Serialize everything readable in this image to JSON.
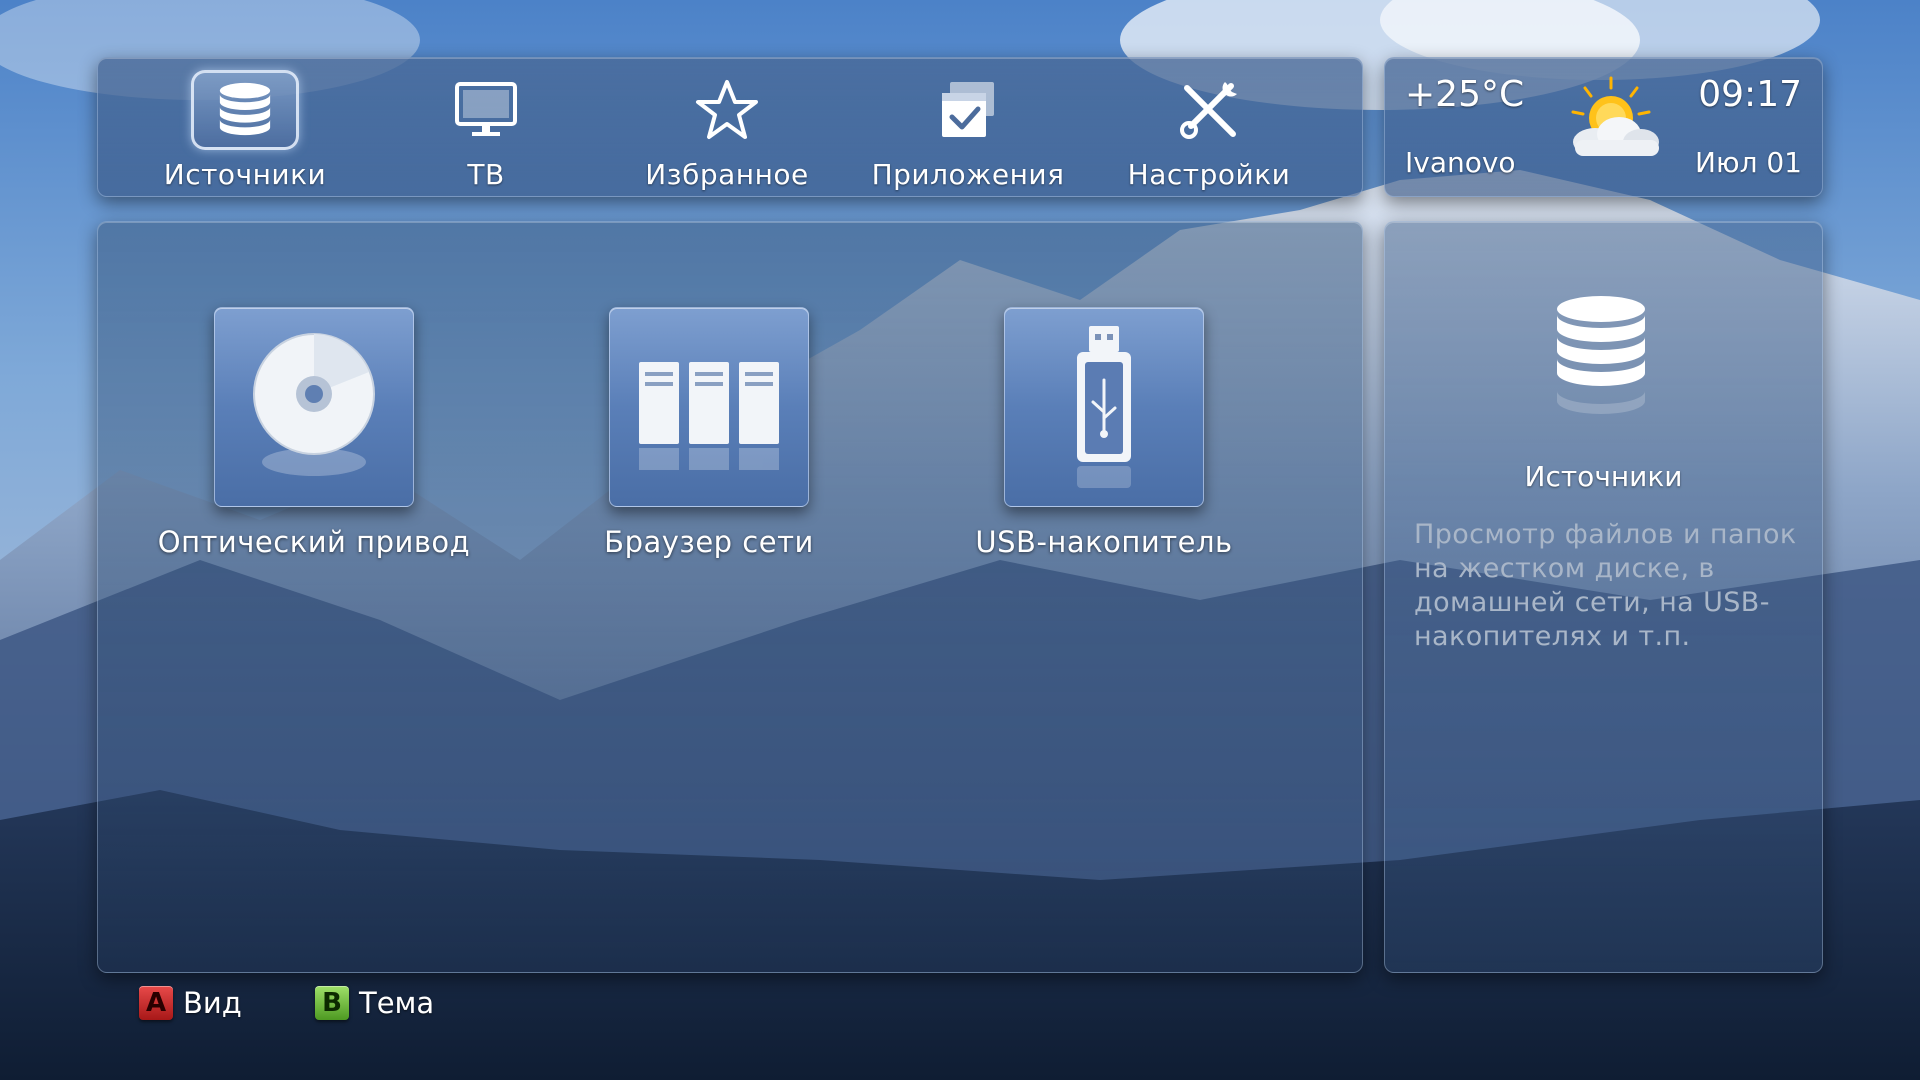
{
  "nav": {
    "items": [
      {
        "label": "Источники",
        "icon": "database-icon",
        "active": true
      },
      {
        "label": "ТВ",
        "icon": "monitor-icon",
        "active": false
      },
      {
        "label": "Избранное",
        "icon": "star-icon",
        "active": false
      },
      {
        "label": "Приложения",
        "icon": "applications-icon",
        "active": false
      },
      {
        "label": "Настройки",
        "icon": "tools-icon",
        "active": false
      }
    ]
  },
  "weather": {
    "temperature": "+25°C",
    "time": "09:17",
    "city": "Ivanovo",
    "date": "Июл 01",
    "icon": "sun-cloud-icon"
  },
  "sources": [
    {
      "label": "Оптический привод",
      "icon": "optical-disc-icon"
    },
    {
      "label": "Браузер сети",
      "icon": "network-servers-icon"
    },
    {
      "label": "USB-накопитель",
      "icon": "usb-drive-icon"
    }
  ],
  "info": {
    "title": "Источники",
    "description": "Просмотр файлов и папок на жестком диске, в домашней сети, на USB-накопителях и т.п.",
    "icon": "database-icon"
  },
  "hints": [
    {
      "key": "A",
      "label": "Вид",
      "color": "#d42a2a"
    },
    {
      "key": "B",
      "label": "Тема",
      "color": "#6cc23a"
    }
  ]
}
